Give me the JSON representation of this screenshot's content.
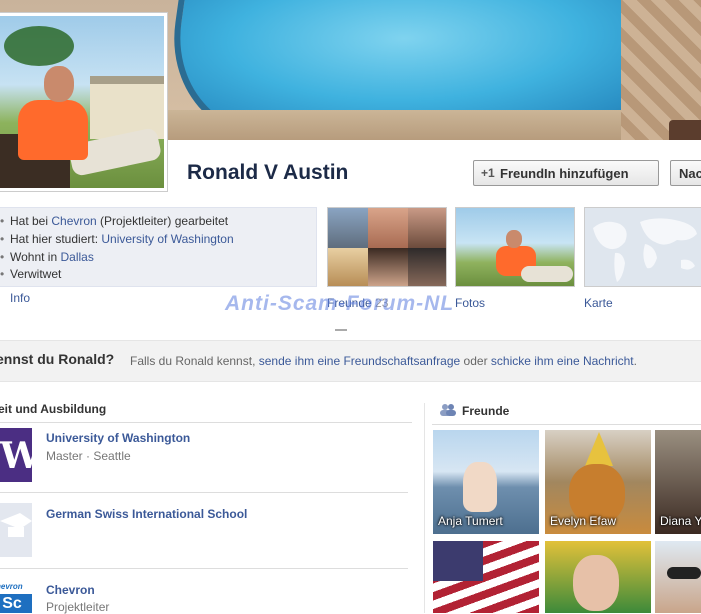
{
  "profile": {
    "name": "Ronald V Austin"
  },
  "actions": {
    "add_friend": "FreundIn hinzufügen",
    "message": "Nac"
  },
  "info": {
    "work_prefix": "Hat bei ",
    "work_company": "Chevron",
    "work_suffix": " (Projektleiter) gearbeitet",
    "study_prefix": "Hat hier studiert: ",
    "study_school": "University of Washington",
    "lives_prefix": "Wohnt in ",
    "lives_city": "Dallas",
    "status": "Verwitwet",
    "label": "Info"
  },
  "thumbs": {
    "friends_label": "Freunde",
    "friends_count": "23",
    "photos_label": "Fotos",
    "map_label": "Karte"
  },
  "watermark": "Anti-Scam-Forum-NL",
  "know": {
    "title": "ennst du Ronald?",
    "text_1": "Falls du Ronald kennst, ",
    "link_1": "sende ihm eine Freundschaftsanfrage",
    "text_2": " oder ",
    "link_2": "schicke ihm eine Nachricht",
    "text_3": "."
  },
  "education": {
    "heading": "eit und Ausbildung",
    "items": [
      {
        "title": "University of Washington",
        "subtitle": "Master · Seattle",
        "logo": "uw-logo"
      },
      {
        "title": "German Swiss International School",
        "subtitle": "",
        "logo": "school-placeholder-icon"
      },
      {
        "title": "Chevron",
        "subtitle": "Projektleiter",
        "logo": "chevron-logo"
      }
    ]
  },
  "friends": {
    "heading": "Freunde",
    "items": [
      {
        "name": "Anja Tumert"
      },
      {
        "name": "Evelyn Efaw"
      },
      {
        "name": "Diana Y"
      },
      {
        "name": ""
      },
      {
        "name": ""
      },
      {
        "name": ""
      }
    ]
  },
  "colors": {
    "link": "#3b5998",
    "name": "#1c2a47",
    "info_bg": "#edeff4",
    "know_bg": "#f2f2f2"
  }
}
